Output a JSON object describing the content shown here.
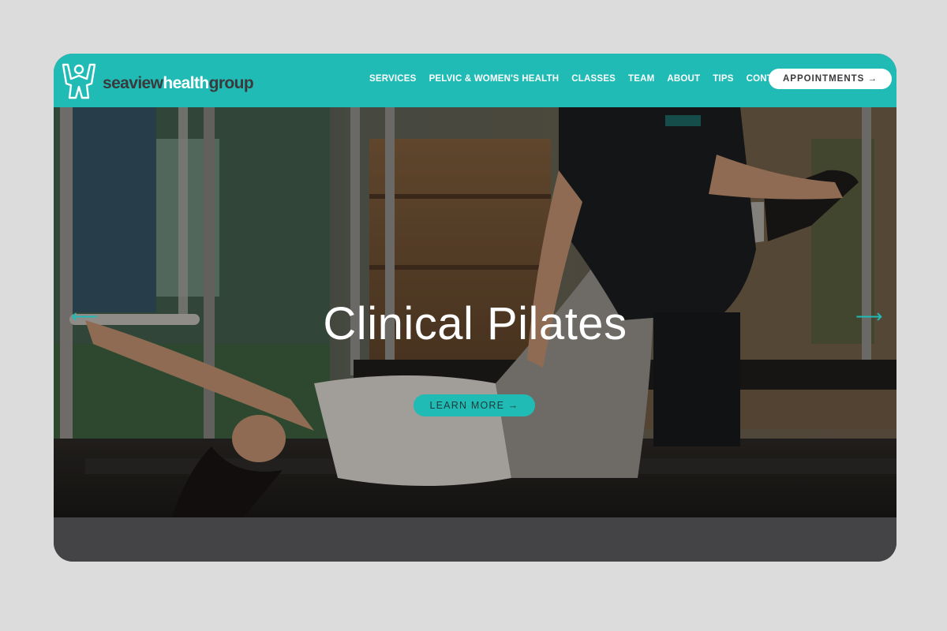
{
  "brand": {
    "name_part1": "seaview",
    "name_part2": "health",
    "name_part3": "group",
    "accent": "#20bbb5",
    "dark": "#3a3a3c"
  },
  "nav": {
    "items": [
      "SERVICES",
      "PELVIC & WOMEN'S HEALTH",
      "CLASSES",
      "TEAM",
      "ABOUT",
      "TIPS",
      "CONTACT"
    ],
    "cta": "APPOINTMENTS →"
  },
  "hero": {
    "title": "Clinical Pilates",
    "button": "LEARN MORE →",
    "prev_icon": "arrow-left-icon",
    "next_icon": "arrow-right-icon"
  }
}
